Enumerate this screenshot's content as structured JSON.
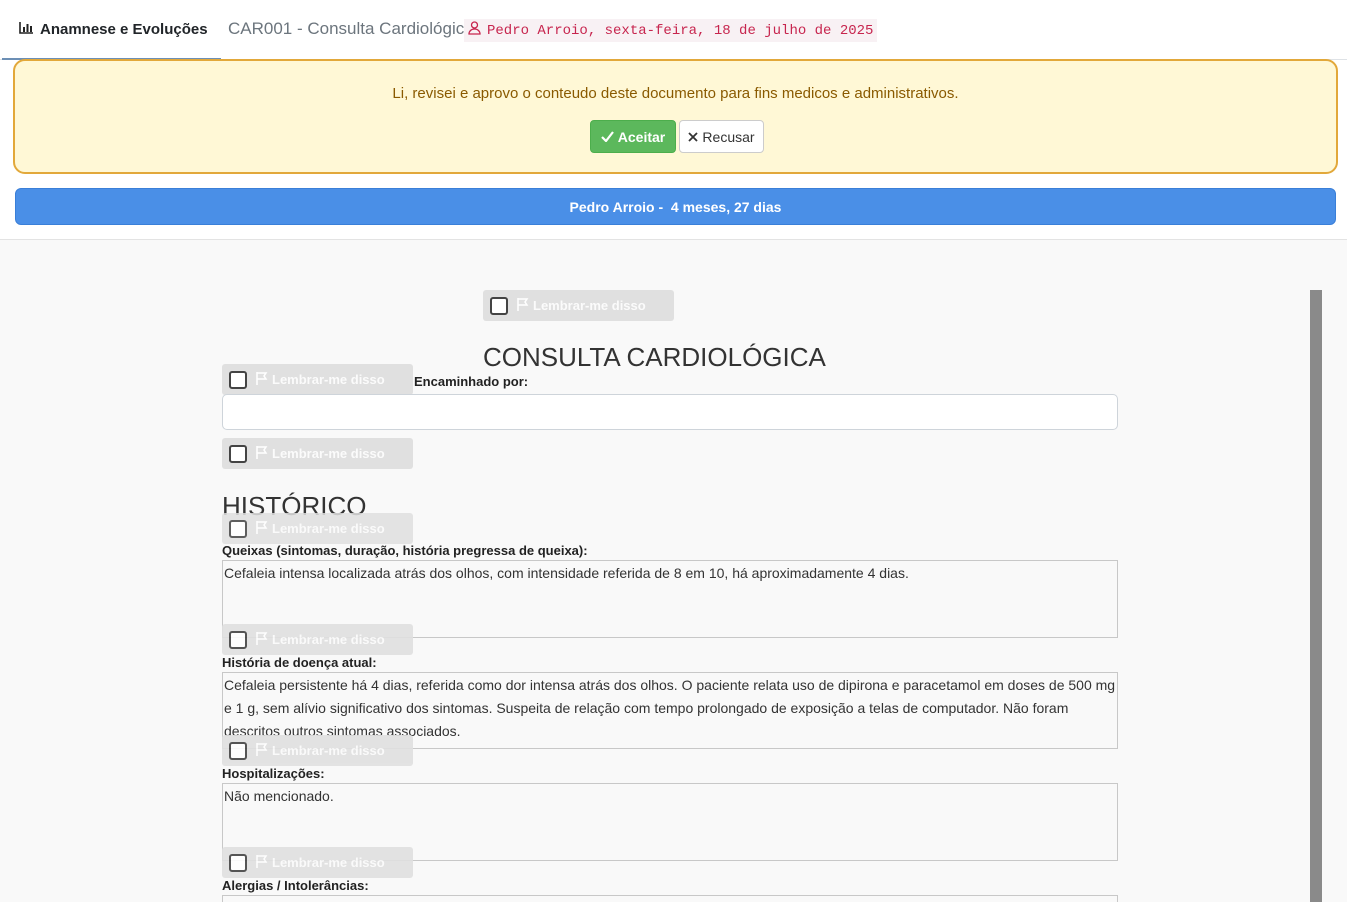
{
  "header": {
    "tab_label": "Anamnese e Evoluções",
    "doc_title": "CAR001 - Consulta Cardiológic",
    "patient_chip": "Pedro Arroio, sexta-feira, 18 de julho de 2025"
  },
  "approval": {
    "message": "Li, revisei e aprovo o conteudo deste documento para fins medicos e administrativos.",
    "accept_label": "Aceitar",
    "reject_label": "Recusar"
  },
  "patient_bar": {
    "text": "Pedro Arroio -  4 meses, 27 dias"
  },
  "form": {
    "remind_label": "Lembrar-me disso",
    "title": "CONSULTA CARDIOLÓGICA",
    "referred_label": "Encaminhado por:",
    "referred_value": "",
    "section_history": "HISTÓRICO",
    "complaints_label": "Queixas (sintomas, duração, história pregressa de queixa):",
    "complaints_value": "Cefaleia intensa localizada atrás dos olhos, com intensidade referida de 8 em 10, há aproximadamente 4 dias.",
    "current_illness_label": "História de doença atual:",
    "current_illness_value": "Cefaleia persistente há 4 dias, referida como dor intensa atrás dos olhos. O paciente relata uso de dipirona e paracetamol em doses de 500 mg e 1 g, sem alívio significativo dos sintomas. Suspeita de relação com tempo prolongado de exposição a telas de computador. Não foram descritos outros sintomas associados.",
    "hospitalizations_label": "Hospitalizações:",
    "hospitalizations_value": "Não mencionado.",
    "allergies_label": "Alergias / Intolerâncias:"
  },
  "colors": {
    "accent_blue": "#4a8fe7",
    "accept_green": "#5cb85c",
    "banner_bg": "#fff8d6",
    "banner_border": "#e2a83a",
    "chip_text": "#c7254e"
  },
  "icons": [
    "chart-bar-icon",
    "user-icon",
    "check-icon",
    "times-icon",
    "flag-icon"
  ]
}
